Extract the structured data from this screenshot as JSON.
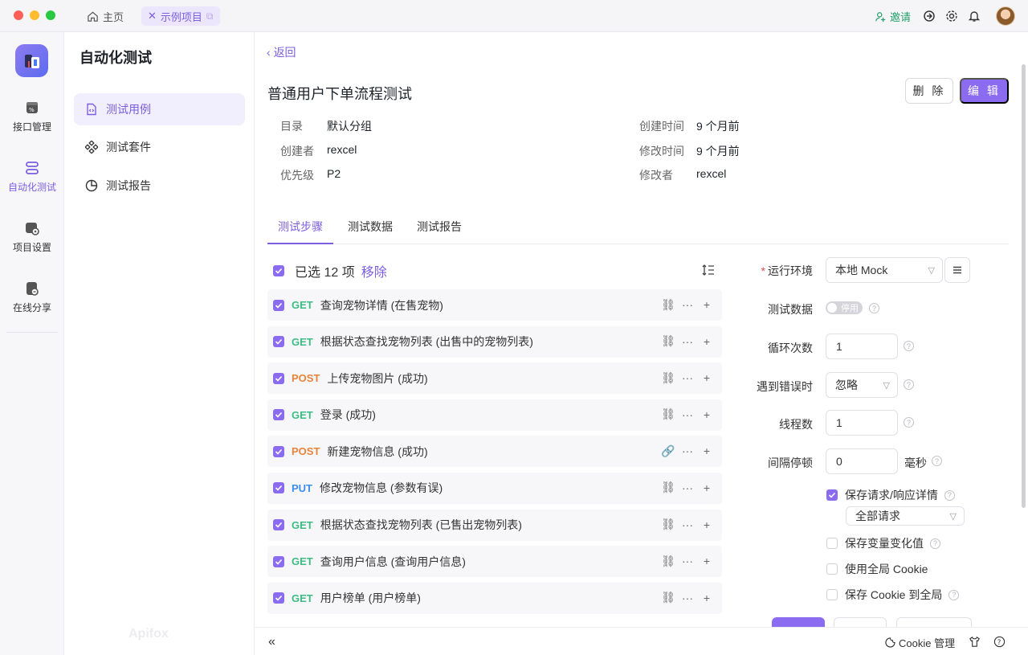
{
  "titlebar": {
    "home_tab": "主页",
    "project_tab": "示例项目",
    "invite": "邀请"
  },
  "rail": {
    "items": [
      {
        "label": "接口管理",
        "icon": "api-icon"
      },
      {
        "label": "自动化测试",
        "icon": "automation-icon",
        "active": true
      },
      {
        "label": "项目设置",
        "icon": "settings-icon"
      },
      {
        "label": "在线分享",
        "icon": "share-icon"
      }
    ]
  },
  "sidebar": {
    "title": "自动化测试",
    "items": [
      {
        "label": "测试用例",
        "icon": "file-code-icon",
        "active": true
      },
      {
        "label": "测试套件",
        "icon": "suite-icon"
      },
      {
        "label": "测试报告",
        "icon": "pie-chart-icon"
      }
    ],
    "watermark": "Apifox"
  },
  "main": {
    "back": "返回",
    "title": "普通用户下单流程测试",
    "delete_btn": "删 除",
    "edit_btn": "编 辑",
    "meta_left": [
      {
        "key": "目录",
        "value": "默认分组"
      },
      {
        "key": "创建者",
        "value": "rexcel"
      },
      {
        "key": "优先级",
        "value": "P2"
      }
    ],
    "meta_right": [
      {
        "key": "创建时间",
        "value": "9 个月前"
      },
      {
        "key": "修改时间",
        "value": "9 个月前"
      },
      {
        "key": "修改者",
        "value": "rexcel"
      }
    ],
    "tabs": [
      "测试步骤",
      "测试数据",
      "测试报告"
    ],
    "selection": {
      "text": "已选 12 项",
      "remove": "移除"
    },
    "steps": [
      {
        "method": "GET",
        "name": "查询宠物详情 (在售宠物)"
      },
      {
        "method": "GET",
        "name": "根据状态查找宠物列表 (出售中的宠物列表)"
      },
      {
        "method": "POST",
        "name": "上传宠物图片 (成功)"
      },
      {
        "method": "GET",
        "name": "登录 (成功)"
      },
      {
        "method": "POST",
        "name": "新建宠物信息 (成功)"
      },
      {
        "method": "PUT",
        "name": "修改宠物信息 (参数有误)"
      },
      {
        "method": "GET",
        "name": "根据状态查找宠物列表 (已售出宠物列表)"
      },
      {
        "method": "GET",
        "name": "查询用户信息 (查询用户信息)"
      },
      {
        "method": "GET",
        "name": "用户榜单 (用户榜单)"
      }
    ]
  },
  "config": {
    "env_label": "运行环境",
    "env_value": "本地 Mock",
    "testdata_label": "测试数据",
    "testdata_toggle": "停用",
    "loop_label": "循环次数",
    "loop_value": "1",
    "onerror_label": "遇到错误时",
    "onerror_value": "忽略",
    "threads_label": "线程数",
    "threads_value": "1",
    "interval_label": "间隔停顿",
    "interval_value": "0",
    "interval_unit": "毫秒",
    "save_detail": "保存请求/响应详情",
    "save_detail_scope": "全部请求",
    "save_var": "保存变量变化值",
    "use_global_cookie": "使用全局 Cookie",
    "save_cookie_global": "保存 Cookie 到全局"
  },
  "bottombar": {
    "cookie_manager": "Cookie 管理"
  },
  "colors": {
    "accent": "#7b5fe0",
    "get": "#3dbb84",
    "post": "#e8833a",
    "put": "#3b8ef0"
  }
}
